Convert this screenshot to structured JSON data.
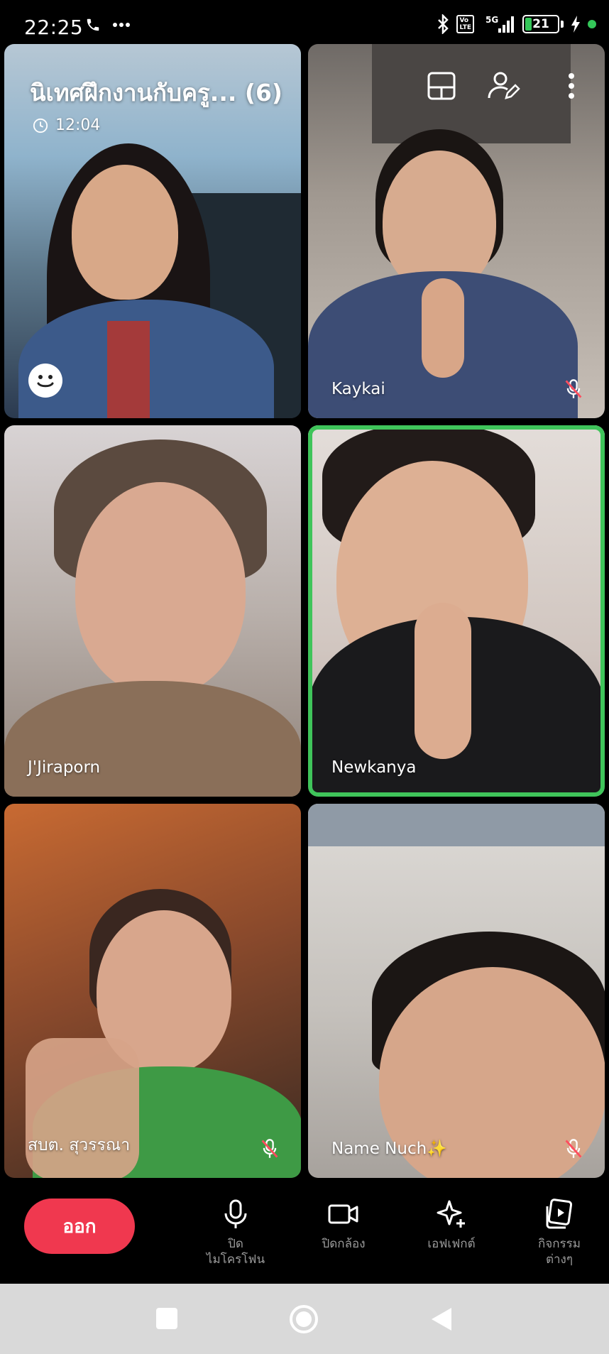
{
  "status": {
    "time": "22:25",
    "left_icons": [
      "phone-icon",
      "more-dots-icon"
    ],
    "network_badge": "Vo\nLTE",
    "network_type": "5G",
    "battery_percent": 21,
    "battery_label": "21"
  },
  "call": {
    "title": "นิเทศฝึกงานกับครู... (6)",
    "timer": "12:04",
    "top_icons": [
      "layout-icon",
      "manage-participants-icon",
      "more-vertical-icon"
    ]
  },
  "participants": [
    {
      "name": "",
      "muted": false,
      "active": false,
      "bg": "#7a8fa3"
    },
    {
      "name": "Kaykai",
      "muted": true,
      "active": false,
      "bg": "#8a7f74"
    },
    {
      "name": "J'Jiraporn",
      "muted": false,
      "active": false,
      "bg": "#a99a8c"
    },
    {
      "name": "Newkanya",
      "muted": false,
      "active": true,
      "bg": "#c9bfb8"
    },
    {
      "name": "สบต. สุวรรณา",
      "muted": true,
      "active": false,
      "bg": "#9a5a35"
    },
    {
      "name": "Name Nuch✨",
      "muted": true,
      "active": false,
      "bg": "#b9b4ae"
    }
  ],
  "controls": {
    "leave_label": "ออก",
    "mic_label_1": "ปิด",
    "mic_label_2": "ไมโครโฟน",
    "camera_label": "ปิดกล้อง",
    "effects_label": "เอฟเฟกต์",
    "activities_label_1": "กิจกรรม",
    "activities_label_2": "ต่างๆ"
  },
  "colors": {
    "accent_red": "#f0384f",
    "active_green": "#3fc45a",
    "battery_green": "#34c759"
  },
  "nav": [
    "recent-apps-icon",
    "home-icon",
    "back-icon"
  ]
}
